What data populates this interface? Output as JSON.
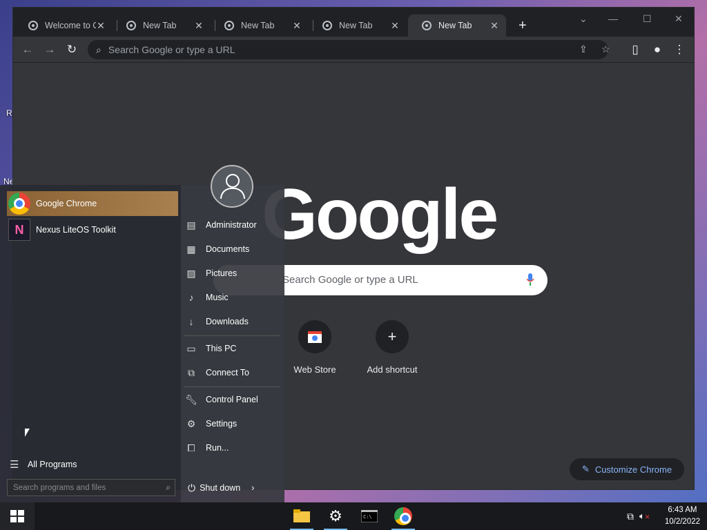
{
  "desktop": {
    "label1": "Re",
    "label2": "Ne"
  },
  "browser": {
    "tabs": [
      {
        "title": "Welcome to Chrome",
        "active": false
      },
      {
        "title": "New Tab",
        "active": false
      },
      {
        "title": "New Tab",
        "active": false
      },
      {
        "title": "New Tab",
        "active": false
      },
      {
        "title": "New Tab",
        "active": true
      }
    ],
    "omnibox_placeholder": "Search Google or type a URL",
    "logo_text": "Google",
    "search_placeholder": "Search Google or type a URL",
    "shortcuts": [
      {
        "label": "Web Store",
        "icon": "web-store-icon"
      },
      {
        "label": "Add shortcut",
        "icon": "plus-icon"
      }
    ],
    "customize_label": "Customize Chrome"
  },
  "startmenu": {
    "programs": [
      {
        "label": "Google Chrome",
        "icon": "chrome-icon",
        "highlighted": true
      },
      {
        "label": "Nexus LiteOS Toolkit",
        "icon": "nexus-icon",
        "highlighted": false
      }
    ],
    "right_items": [
      {
        "label": "Administrator",
        "icon": "user-folder-icon"
      },
      {
        "label": "Documents",
        "icon": "document-icon"
      },
      {
        "label": "Pictures",
        "icon": "picture-icon"
      },
      {
        "label": "Music",
        "icon": "music-icon"
      },
      {
        "label": "Downloads",
        "icon": "download-icon"
      },
      {
        "label": "This PC",
        "icon": "computer-icon"
      },
      {
        "label": "Connect To",
        "icon": "network-icon"
      },
      {
        "label": "Control Panel",
        "icon": "wrench-icon"
      },
      {
        "label": "Settings",
        "icon": "gear-icon"
      },
      {
        "label": "Run...",
        "icon": "run-icon"
      }
    ],
    "all_programs": "All Programs",
    "search_placeholder": "Search programs and files",
    "shutdown": "Shut down"
  },
  "taskbar": {
    "apps": [
      "file-explorer-icon",
      "settings-icon",
      "terminal-icon",
      "chrome-icon"
    ],
    "time": "6:43 AM",
    "date": "10/2/2022"
  }
}
